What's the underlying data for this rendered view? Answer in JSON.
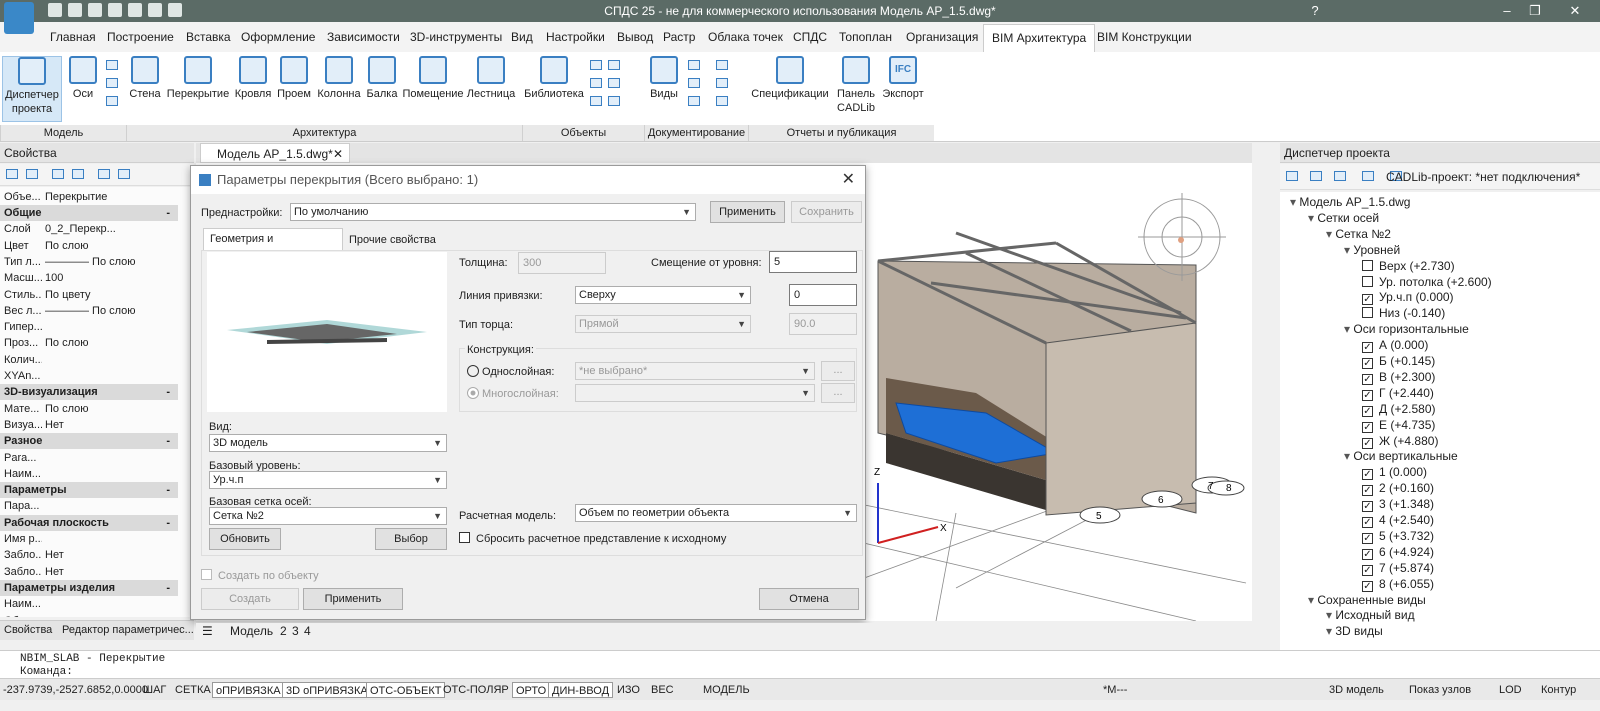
{
  "window": {
    "title": "СПДС 25 - не для коммерческого использования Модель АР_1.5.dwg*",
    "help": "?"
  },
  "menu": [
    "Главная",
    "Построение",
    "Вставка",
    "Оформление",
    "Зависимости",
    "3D-инструменты",
    "Вид",
    "Настройки",
    "Вывод",
    "Растр",
    "Облака точек",
    "СПДС",
    "Топоплан",
    "Организация",
    "BIM Архитектура",
    "BIM Конструкции"
  ],
  "ribbon": {
    "buttons": [
      "Диспетчер проекта",
      "Оси",
      "Стена",
      "Перекрытие",
      "Кровля",
      "Проем",
      "Колонна",
      "Балка",
      "Помещение",
      "Лестница",
      "Библиотека",
      "Виды",
      "Спецификации",
      "Панель CADLib",
      "Экспорт"
    ],
    "groups": [
      "Модель",
      "Архитектура",
      "Объекты",
      "Документирование",
      "Отчеты и публикация"
    ],
    "ifc": "IFC"
  },
  "properties": {
    "title": "Свойства",
    "object_label": "Объе...",
    "object_value": "Перекрытие",
    "rows": [
      {
        "k": "Общие",
        "cat": true
      },
      {
        "k": "Слой",
        "v": "0_2_Перекр..."
      },
      {
        "k": "Цвет",
        "v": "По слою"
      },
      {
        "k": "Тип л...",
        "v": "———— По слою"
      },
      {
        "k": "Масш...",
        "v": "100"
      },
      {
        "k": "Стиль...",
        "v": "По цвету"
      },
      {
        "k": "Вес л...",
        "v": "———— По слою"
      },
      {
        "k": "Гипер...",
        "v": ""
      },
      {
        "k": "Проз...",
        "v": "По слою"
      },
      {
        "k": "Колич...",
        "v": ""
      },
      {
        "k": "XYAn...",
        "v": ""
      },
      {
        "k": "3D-визуализация",
        "cat": true
      },
      {
        "k": "Мате...",
        "v": "По слою"
      },
      {
        "k": "Визуа...",
        "v": "Нет"
      },
      {
        "k": "Разное",
        "cat": true
      },
      {
        "k": "Para...",
        "v": ""
      },
      {
        "k": "Наим...",
        "v": ""
      },
      {
        "k": "Параметры",
        "cat": true
      },
      {
        "k": "Пара...",
        "v": ""
      },
      {
        "k": "Рабочая плоскость",
        "cat": true
      },
      {
        "k": "Имя р...",
        "v": ""
      },
      {
        "k": "Забло...",
        "v": "Нет"
      },
      {
        "k": "Забло...",
        "v": "Нет"
      },
      {
        "k": "Параметры изделия",
        "cat": true
      },
      {
        "k": "Наим...",
        "v": ""
      },
      {
        "k": "Обоз...",
        "v": ""
      }
    ],
    "tabs": [
      "Свойства",
      "Редактор параметричес..."
    ]
  },
  "doc_tab": "Модель АР_1.5.dwg*",
  "layout_tabs": [
    "Модель",
    "2",
    "3",
    "4"
  ],
  "dialog": {
    "title": "Параметры перекрытия (Всего выбрано: 1)",
    "preset_label": "Преднастройки:",
    "preset_value": "По умолчанию",
    "apply": "Применить",
    "save": "Сохранить",
    "tabs": [
      "Геометрия и расположение",
      "Прочие свойства"
    ],
    "view_label": "Вид:",
    "view_value": "3D модель",
    "base_level_label": "Базовый уровень:",
    "base_level_value": "Ур.ч.п",
    "grid_label": "Базовая сетка осей:",
    "grid_value": "Сетка №2",
    "refresh": "Обновить",
    "select": "Выбор",
    "thickness_label": "Толщина:",
    "thickness_value": "300",
    "offset_label": "Смещение от уровня:",
    "offset_value": "5",
    "anchor_label": "Линия привязки:",
    "anchor_value": "Сверху",
    "anchor_offset": "0",
    "edge_label": "Тип торца:",
    "edge_value": "Прямой",
    "edge_angle": "90.0",
    "construction_label": "Конструкция:",
    "single": "Однослойная:",
    "single_value": "*не выбрано*",
    "multi": "Многослойная:",
    "dots": "...",
    "calc_label": "Расчетная модель:",
    "calc_value": "Объем по геометрии объекта",
    "reset": "Сбросить расчетное представление к исходному",
    "create_by": "Создать по объекту",
    "create": "Создать",
    "apply2": "Применить",
    "cancel": "Отмена"
  },
  "viewport": {
    "axis_z": "Z",
    "axis_x": "X",
    "labels": [
      "5",
      "6",
      "7",
      "8"
    ]
  },
  "manager": {
    "title": "Диспетчер проекта",
    "cadlib": "CADLib-проект:  *нет подключения*",
    "tree": [
      {
        "t": "Модель АР_1.5.dwg",
        "lvl": 0
      },
      {
        "t": "Сетки осей",
        "lvl": 1
      },
      {
        "t": "Сетка №2",
        "lvl": 2
      },
      {
        "t": "Уровней",
        "lvl": 3
      },
      {
        "t": "Верх (+2.730)",
        "lvl": 4,
        "cb": false
      },
      {
        "t": "Ур. потолка (+2.600)",
        "lvl": 4,
        "cb": false
      },
      {
        "t": "Ур.ч.п (0.000)",
        "lvl": 4,
        "cb": true
      },
      {
        "t": "Низ (-0.140)",
        "lvl": 4,
        "cb": false
      },
      {
        "t": "Оси горизонтальные",
        "lvl": 3
      },
      {
        "t": "А (0.000)",
        "lvl": 4,
        "cb": true
      },
      {
        "t": "Б (+0.145)",
        "lvl": 4,
        "cb": true
      },
      {
        "t": "В (+2.300)",
        "lvl": 4,
        "cb": true
      },
      {
        "t": "Г (+2.440)",
        "lvl": 4,
        "cb": true
      },
      {
        "t": "Д (+2.580)",
        "lvl": 4,
        "cb": true
      },
      {
        "t": "Е (+4.735)",
        "lvl": 4,
        "cb": true
      },
      {
        "t": "Ж (+4.880)",
        "lvl": 4,
        "cb": true
      },
      {
        "t": "Оси вертикальные",
        "lvl": 3
      },
      {
        "t": "1 (0.000)",
        "lvl": 4,
        "cb": true
      },
      {
        "t": "2 (+0.160)",
        "lvl": 4,
        "cb": true
      },
      {
        "t": "3 (+1.348)",
        "lvl": 4,
        "cb": true
      },
      {
        "t": "4 (+2.540)",
        "lvl": 4,
        "cb": true
      },
      {
        "t": "5 (+3.732)",
        "lvl": 4,
        "cb": true
      },
      {
        "t": "6 (+4.924)",
        "lvl": 4,
        "cb": true
      },
      {
        "t": "7 (+5.874)",
        "lvl": 4,
        "cb": true
      },
      {
        "t": "8 (+6.055)",
        "lvl": 4,
        "cb": true
      },
      {
        "t": "Сохраненные виды",
        "lvl": 1
      },
      {
        "t": "Исходный вид",
        "lvl": 2
      },
      {
        "t": "3D виды",
        "lvl": 2
      }
    ]
  },
  "command": {
    "history": "NBIM_SLAB - Перекрытие",
    "prompt": "Команда:"
  },
  "status": {
    "coords": "-237.9739,-2527.6852,0.0000",
    "toggles": [
      {
        "t": "ШАГ",
        "on": false
      },
      {
        "t": "СЕТКА",
        "on": false
      },
      {
        "t": "оПРИВЯЗКА",
        "on": true
      },
      {
        "t": "3D оПРИВЯЗКА",
        "on": true
      },
      {
        "t": "ОТС-ОБЪЕКТ",
        "on": true
      },
      {
        "t": "ОТС-ПОЛЯР",
        "on": false
      },
      {
        "t": "ОРТО",
        "on": true
      },
      {
        "t": "ДИН-ВВОД",
        "on": true
      },
      {
        "t": "ИЗО",
        "on": false
      },
      {
        "t": "ВЕС",
        "on": false
      }
    ],
    "model": "МОДЕЛЬ",
    "scale": "*М---",
    "right": [
      "3D модель",
      "Показ узлов",
      "LOD",
      "Контур"
    ]
  }
}
